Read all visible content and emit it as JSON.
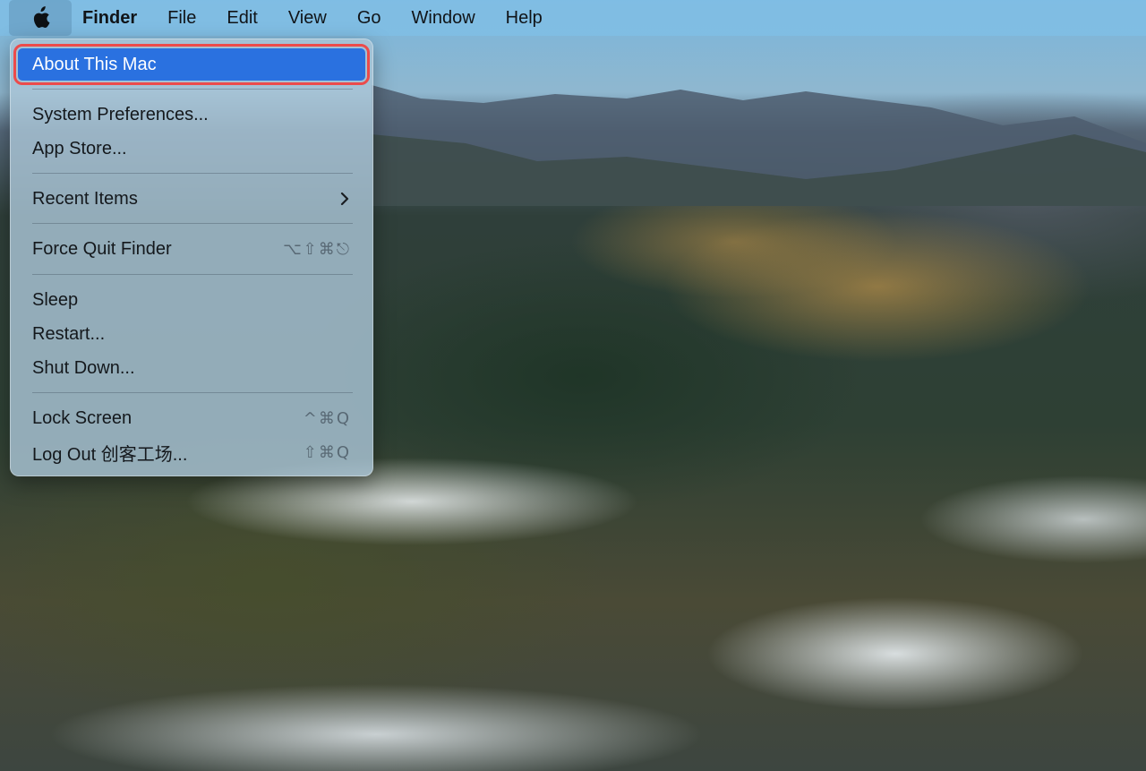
{
  "menubar": {
    "apple_icon": "apple-logo-icon",
    "app_name": "Finder",
    "items": [
      "File",
      "Edit",
      "View",
      "Go",
      "Window",
      "Help"
    ]
  },
  "apple_menu": {
    "about": "About This Mac",
    "system_preferences": "System Preferences...",
    "app_store": "App Store...",
    "recent_items": "Recent Items",
    "recent_items_icon": "chevron-right-icon",
    "force_quit": "Force Quit Finder",
    "force_quit_shortcut": "⌥⇧⌘⎋",
    "sleep": "Sleep",
    "restart": "Restart...",
    "shut_down": "Shut Down...",
    "lock_screen": "Lock Screen",
    "lock_screen_shortcut": "^⌘Q",
    "log_out": "Log Out 创客工场...",
    "log_out_shortcut": "⇧⌘Q"
  },
  "colors": {
    "highlight": "#2a71e0",
    "highlight_outline": "#ec4b4b",
    "menubar": "#80bee4"
  }
}
